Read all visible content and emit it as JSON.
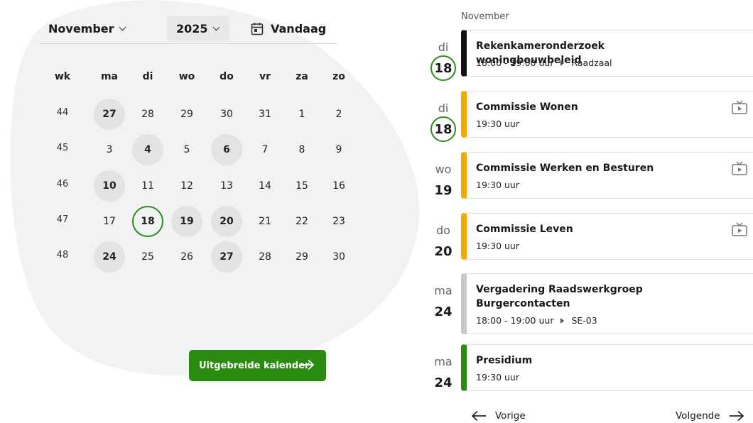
{
  "calendar": {
    "month": "November",
    "year": "2025",
    "today_label": "Vandaag",
    "headers": [
      "wk",
      "ma",
      "di",
      "wo",
      "do",
      "vr",
      "za",
      "zo"
    ],
    "weeks": [
      {
        "wk": "44",
        "days": [
          {
            "d": "27",
            "s": "ev"
          },
          {
            "d": "28"
          },
          {
            "d": "29"
          },
          {
            "d": "30"
          },
          {
            "d": "31"
          },
          {
            "d": "1"
          },
          {
            "d": "2"
          }
        ]
      },
      {
        "wk": "45",
        "days": [
          {
            "d": "3"
          },
          {
            "d": "4",
            "s": "ev"
          },
          {
            "d": "5"
          },
          {
            "d": "6",
            "s": "ev"
          },
          {
            "d": "7"
          },
          {
            "d": "8"
          },
          {
            "d": "9"
          }
        ]
      },
      {
        "wk": "46",
        "days": [
          {
            "d": "10",
            "s": "ev"
          },
          {
            "d": "11"
          },
          {
            "d": "12"
          },
          {
            "d": "13"
          },
          {
            "d": "14"
          },
          {
            "d": "15"
          },
          {
            "d": "16"
          }
        ]
      },
      {
        "wk": "47",
        "days": [
          {
            "d": "17"
          },
          {
            "d": "18",
            "s": "today"
          },
          {
            "d": "19",
            "s": "ev"
          },
          {
            "d": "20",
            "s": "ev"
          },
          {
            "d": "21"
          },
          {
            "d": "22"
          },
          {
            "d": "23"
          }
        ]
      },
      {
        "wk": "48",
        "days": [
          {
            "d": "24",
            "s": "ev"
          },
          {
            "d": "25"
          },
          {
            "d": "26"
          },
          {
            "d": "27",
            "s": "ev"
          },
          {
            "d": "28"
          },
          {
            "d": "29"
          },
          {
            "d": "30"
          }
        ]
      }
    ],
    "extended_button": "Uitgebreide kalender"
  },
  "agenda": {
    "month_label": "November",
    "events": [
      {
        "dow": "di",
        "day": "18",
        "today": true,
        "title": "Rekenkameronderzoek woningbouwbeleid",
        "time": "18:00 - 19:00 uur",
        "location": "Raadzaal",
        "bar": "#111111",
        "tv": false
      },
      {
        "dow": "di",
        "day": "18",
        "today": true,
        "title": "Commissie Wonen",
        "time": "19:30 uur",
        "location": "",
        "bar": "#f5a800",
        "tv": true
      },
      {
        "dow": "wo",
        "day": "19",
        "today": false,
        "title": "Commissie Werken en Besturen",
        "time": "19:30 uur",
        "location": "",
        "bar": "#f5a800",
        "tv": true
      },
      {
        "dow": "do",
        "day": "20",
        "today": false,
        "title": "Commissie Leven",
        "time": "19:30 uur",
        "location": "",
        "bar": "#f5a800",
        "tv": true
      },
      {
        "dow": "ma",
        "day": "24",
        "today": false,
        "title": "Vergadering Raadswerkgroep Burgercontacten",
        "time": "18:00 - 19:00 uur",
        "location": "SE-03",
        "bar": "#c8c8c8",
        "tv": false
      },
      {
        "dow": "ma",
        "day": "24",
        "today": false,
        "title": "Presidium",
        "time": "19:30 uur",
        "location": "",
        "bar": "#2b8a10",
        "tv": false
      }
    ],
    "prev_label": "Vorige",
    "next_label": "Volgende"
  },
  "colors": {
    "accent_green": "#2b8a10",
    "today_ring": "#2e8b1d",
    "event_day_bg": "#e3e3e3",
    "blob": "#f1f2f3"
  }
}
